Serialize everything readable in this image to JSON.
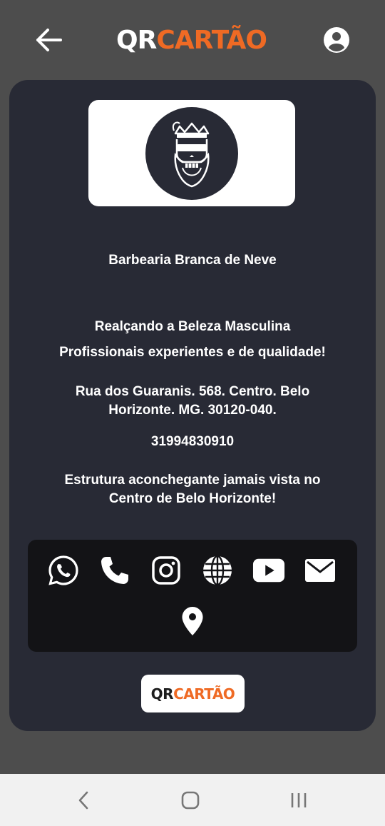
{
  "header": {
    "brand_qr": "QR",
    "brand_cartao": "CARTÃO",
    "back_icon": "arrow-left-icon",
    "profile_icon": "account-circle-icon"
  },
  "card": {
    "logo_icon": "bearded-skull-with-crown-logo",
    "name": "Barbearia Branca de Neve",
    "slogan": "Realçando a Beleza Masculina",
    "subtitle": "Profissionais experientes e de qualidade!",
    "address": "Rua dos Guaranis. 568. Centro. Belo Horizonte. MG. 30120-040.",
    "phone": "31994830910",
    "description": "Estrutura aconchegante jamais vista no Centro de Belo Horizonte!"
  },
  "social": {
    "icons": [
      "whatsapp-icon",
      "phone-icon",
      "instagram-icon",
      "globe-icon",
      "youtube-icon",
      "email-icon",
      "location-pin-icon"
    ]
  },
  "footer": {
    "brand_qr": "QR",
    "brand_cartao": "CARTÃO"
  },
  "system_nav": {
    "icons": [
      "back-chevron-icon",
      "home-icon",
      "recent-apps-icon"
    ]
  },
  "colors": {
    "background": "#4d4d4d",
    "card": "#282a35",
    "social_panel": "#131316",
    "accent": "#ef6a24",
    "text": "#ffffff"
  }
}
